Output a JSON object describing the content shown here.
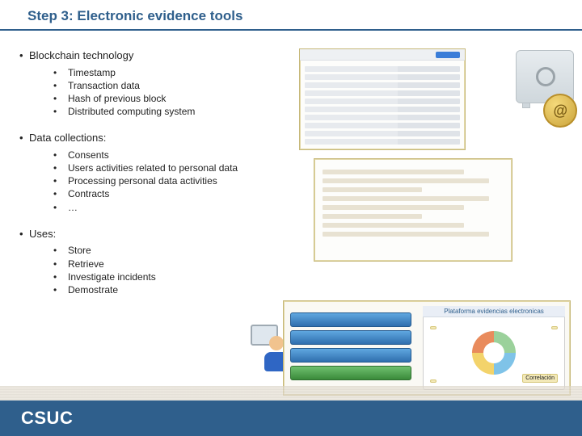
{
  "title": "Step 3: Electronic evidence tools",
  "sections": [
    {
      "heading": "Blockchain technology",
      "items": [
        "Timestamp",
        "Transaction data",
        "Hash of previous block",
        "Distributed computing system"
      ]
    },
    {
      "heading": "Data collections:",
      "items": [
        "Consents",
        "Users activities related to personal data",
        "Processing personal data activities",
        "Contracts",
        "…"
      ]
    },
    {
      "heading": "Uses:",
      "items": [
        "Store",
        "Retrieve",
        "Investigate incidents",
        "Demostrate"
      ]
    }
  ],
  "logo_text": "CSUC",
  "coin_glyph": "@",
  "diagram": {
    "panel_title": "Plataforma evidencias electronicas",
    "tag_right": "Correlación"
  }
}
